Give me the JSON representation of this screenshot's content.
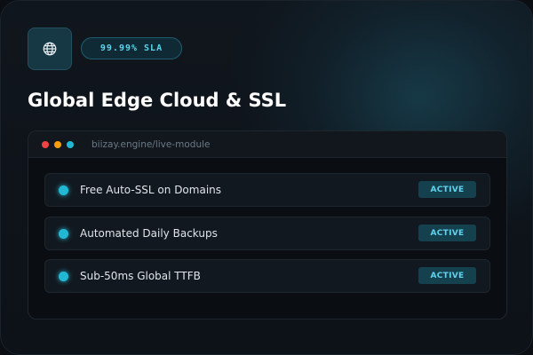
{
  "header": {
    "icon": "globe-icon",
    "sla_badge": "99.99% SLA",
    "title": "Global Edge Cloud & SSL"
  },
  "window": {
    "url": "biizay.engine/live-module",
    "controls": [
      {
        "name": "close",
        "color": "#ef4444"
      },
      {
        "name": "minimize",
        "color": "#f59e0b"
      },
      {
        "name": "zoom",
        "color": "#22b8d4"
      }
    ],
    "items": [
      {
        "label": "Free Auto-SSL on Domains",
        "status": "ACTIVE"
      },
      {
        "label": "Automated Daily Backups",
        "status": "ACTIVE"
      },
      {
        "label": "Sub-50ms Global TTFB",
        "status": "ACTIVE"
      }
    ]
  },
  "colors": {
    "accent": "#22b8d4",
    "accent_text": "#5fd4ec",
    "background": "#0d1218",
    "title": "#ffffff"
  }
}
